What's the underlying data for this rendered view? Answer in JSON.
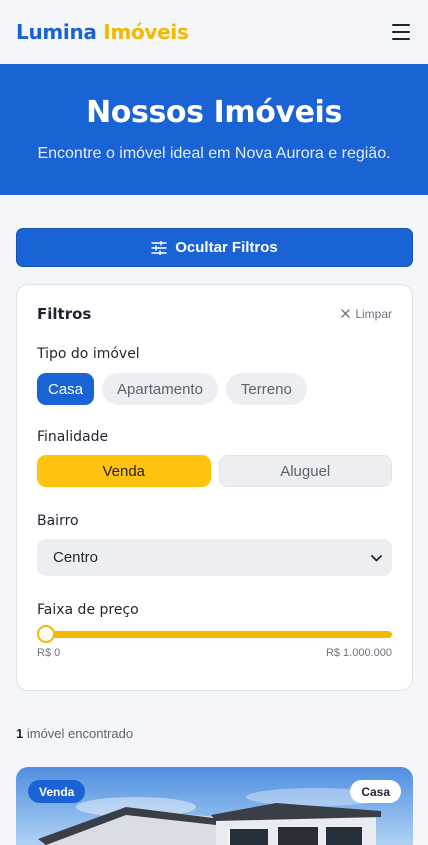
{
  "brand": {
    "part1": "Lumina",
    "part2": "Imóveis",
    "color1": "#1a63d4",
    "color2": "#f5b800"
  },
  "header": {
    "menu_icon": "hamburger-menu-icon"
  },
  "hero": {
    "title": "Nossos Imóveis",
    "subtitle": "Encontre o imóvel ideal em Nova Aurora e região."
  },
  "filters_toggle": {
    "label": "Ocultar Filtros",
    "icon": "sliders-icon"
  },
  "filters": {
    "title": "Filtros",
    "clear_label": "Limpar",
    "type": {
      "label": "Tipo do imóvel",
      "options": [
        "Casa",
        "Apartamento",
        "Terreno"
      ],
      "selected": "Casa"
    },
    "purpose": {
      "label": "Finalidade",
      "options": [
        "Venda",
        "Aluguel"
      ],
      "selected": "Venda"
    },
    "neighborhood": {
      "label": "Bairro",
      "value": "Centro"
    },
    "price": {
      "label": "Faixa de preço",
      "min_label": "R$ 0",
      "max_label": "R$ 1.000.000",
      "thumb_position_fraction": 0
    }
  },
  "results": {
    "count": "1",
    "suffix": " imóvel encontrado"
  },
  "listing": {
    "badge_purpose": "Venda",
    "badge_type": "Casa"
  },
  "colors": {
    "primary": "#1a63d4",
    "accent": "#ffc20e",
    "background": "#f4f6fa"
  }
}
